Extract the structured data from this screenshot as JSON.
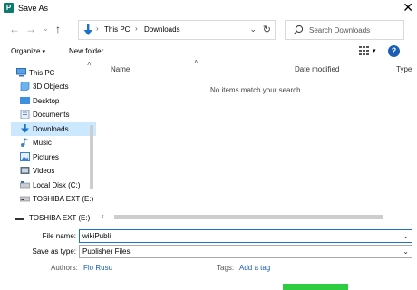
{
  "window": {
    "title": "Save As",
    "app_icon_letter": "P",
    "accent": "#0e7a6e"
  },
  "address": {
    "crumbs": [
      "This PC",
      "Downloads"
    ],
    "separator": "›"
  },
  "search": {
    "placeholder": "Search Downloads"
  },
  "toolbar": {
    "organize_label": "Organize",
    "new_folder_label": "New folder"
  },
  "nav_pane": {
    "items": [
      {
        "label": "This PC",
        "icon": "monitor-icon"
      },
      {
        "label": "3D Objects",
        "icon": "3d-objects-icon"
      },
      {
        "label": "Desktop",
        "icon": "desktop-icon"
      },
      {
        "label": "Documents",
        "icon": "documents-icon"
      },
      {
        "label": "Downloads",
        "icon": "downloads-icon",
        "selected": true
      },
      {
        "label": "Music",
        "icon": "music-icon"
      },
      {
        "label": "Pictures",
        "icon": "pictures-icon"
      },
      {
        "label": "Videos",
        "icon": "videos-icon"
      },
      {
        "label": "Local Disk (C:)",
        "icon": "drive-icon"
      },
      {
        "label": "TOSHIBA EXT (E:)",
        "icon": "usb-drive-icon"
      }
    ],
    "bottom_drive": "TOSHIBA EXT (E:)"
  },
  "file_list": {
    "columns": [
      "Name",
      "Date modified",
      "Type"
    ],
    "empty_message": "No items match your search."
  },
  "form": {
    "file_name_label": "File name:",
    "file_name_value": "wikiPubli",
    "save_type_label": "Save as type:",
    "save_type_value": "Publisher Files",
    "authors_label": "Authors:",
    "authors_value": "Flo Rusu",
    "tags_label": "Tags:",
    "tags_value": "Add a tag"
  },
  "colors": {
    "selection": "#cce8ff",
    "link": "#1a5fb4",
    "save_highlight": "#2ecc40"
  }
}
